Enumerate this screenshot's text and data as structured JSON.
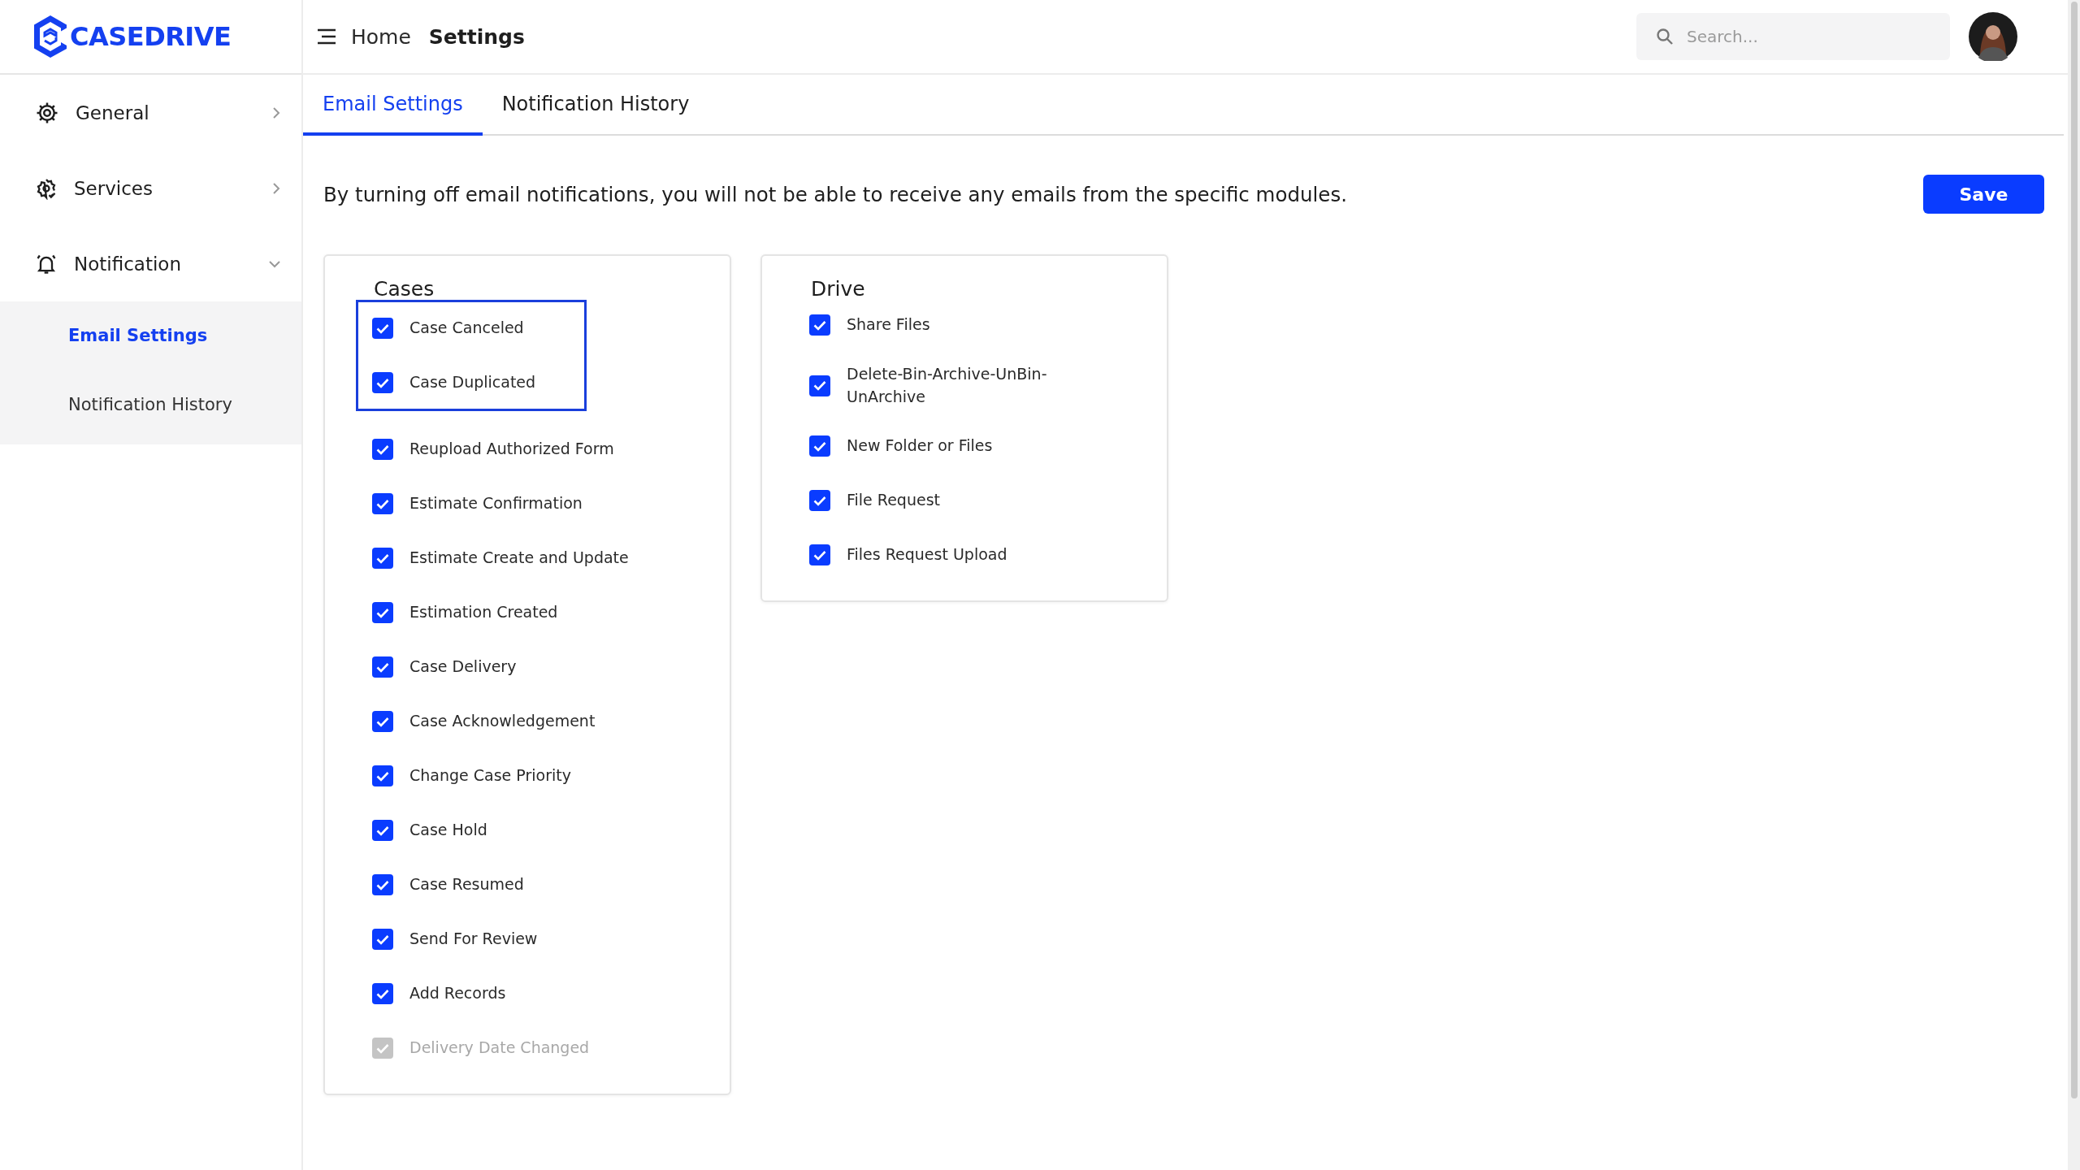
{
  "logo": {
    "text": "CASEDRIVE"
  },
  "header": {
    "breadcrumb": [
      {
        "label": "Home",
        "current": false
      },
      {
        "label": "Settings",
        "current": true
      }
    ],
    "search": {
      "placeholder": "Search..."
    }
  },
  "sidebar": {
    "items": [
      {
        "label": "General",
        "kind": "gear",
        "expanded": false
      },
      {
        "label": "Services",
        "kind": "services",
        "expanded": false
      },
      {
        "label": "Notification",
        "kind": "bell",
        "expanded": true,
        "children": [
          {
            "label": "Email Settings",
            "selected": true
          },
          {
            "label": "Notification History",
            "selected": false
          }
        ]
      }
    ]
  },
  "tabs": [
    {
      "label": "Email Settings",
      "selected": true
    },
    {
      "label": "Notification History",
      "selected": false
    }
  ],
  "notice": "By turning off email notifications, you will not be able to receive any emails from the specific modules.",
  "save_button": "Save",
  "groups": [
    {
      "title": "Cases",
      "items": [
        {
          "label": "Case Canceled",
          "checked": true,
          "disabled": false,
          "focused": true
        },
        {
          "label": "Case Duplicated",
          "checked": true,
          "disabled": false,
          "focused": true
        },
        {
          "label": "Reupload Authorized Form",
          "checked": true,
          "disabled": false,
          "focused": false
        },
        {
          "label": "Estimate Confirmation",
          "checked": true,
          "disabled": false,
          "focused": false
        },
        {
          "label": "Estimate Create and Update",
          "checked": true,
          "disabled": false,
          "focused": false
        },
        {
          "label": "Estimation Created",
          "checked": true,
          "disabled": false,
          "focused": false
        },
        {
          "label": "Case Delivery",
          "checked": true,
          "disabled": false,
          "focused": false
        },
        {
          "label": "Case Acknowledgement",
          "checked": true,
          "disabled": false,
          "focused": false
        },
        {
          "label": "Change Case Priority",
          "checked": true,
          "disabled": false,
          "focused": false
        },
        {
          "label": "Case Hold",
          "checked": true,
          "disabled": false,
          "focused": false
        },
        {
          "label": "Case Resumed",
          "checked": true,
          "disabled": false,
          "focused": false
        },
        {
          "label": "Send For Review",
          "checked": true,
          "disabled": false,
          "focused": false
        },
        {
          "label": "Add Records",
          "checked": true,
          "disabled": false,
          "focused": false
        },
        {
          "label": "Delivery Date Changed",
          "checked": true,
          "disabled": true,
          "focused": false
        }
      ]
    },
    {
      "title": "Drive",
      "items": [
        {
          "label": "Share Files",
          "checked": true,
          "disabled": false,
          "focused": false
        },
        {
          "label": "Delete-Bin-Archive-UnBin-UnArchive",
          "checked": true,
          "disabled": false,
          "focused": false
        },
        {
          "label": "New Folder or Files",
          "checked": true,
          "disabled": false,
          "focused": false
        },
        {
          "label": "File Request",
          "checked": true,
          "disabled": false,
          "focused": false
        },
        {
          "label": "Files Request Upload",
          "checked": true,
          "disabled": false,
          "focused": false
        }
      ]
    }
  ]
}
